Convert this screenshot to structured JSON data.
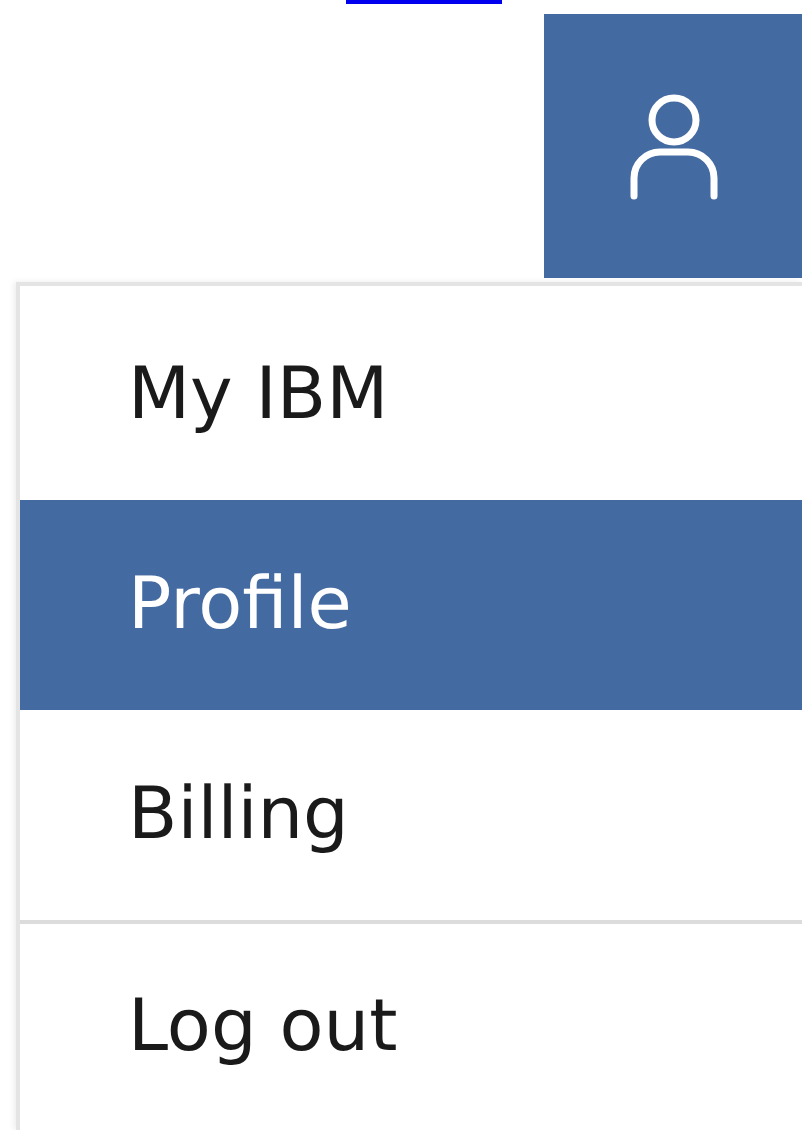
{
  "menu": {
    "items": [
      {
        "label": "My IBM",
        "selected": false,
        "divider_before": false
      },
      {
        "label": "Profile",
        "selected": true,
        "divider_before": false
      },
      {
        "label": "Billing",
        "selected": false,
        "divider_before": false
      },
      {
        "label": "Log out",
        "selected": false,
        "divider_before": true
      }
    ]
  }
}
